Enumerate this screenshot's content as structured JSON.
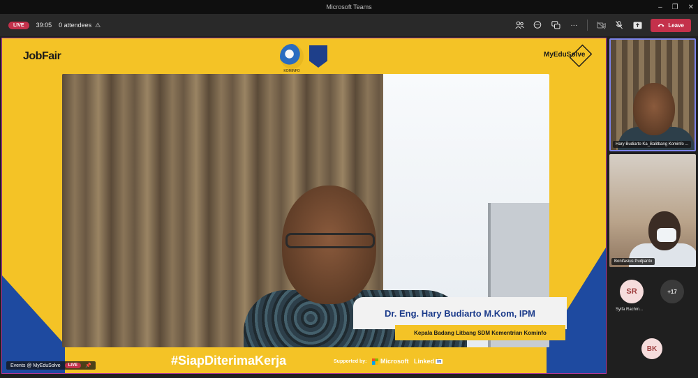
{
  "window": {
    "title": "Microsoft Teams",
    "controls": [
      "–",
      "❐",
      "✕"
    ]
  },
  "toolbar": {
    "live_badge": "LIVE",
    "timer": "39:05",
    "attendees": "0 attendees",
    "leave_label": "Leave"
  },
  "stage": {
    "brand_left": "JobFair",
    "kominfo_label": "KOMINFO",
    "brand_right": "MyEduSolve",
    "speaker_name": "Dr. Eng. Hary Budiarto M.Kom, IPM",
    "speaker_title": "Kepala Badang Litbang SDM Kementrian Kominfo",
    "hashtag": "#SiapDiterimaKerja",
    "supported_by": "Supported by:",
    "sponsor_1": "Microsoft",
    "sponsor_2": "Linked",
    "sponsor_2_box": "in",
    "event_label": "Events @ MyEduSolve",
    "event_live": "LIVE"
  },
  "participants": {
    "tile1_name": "Hary Budiarto Ka_Balitbang Kominfo ...",
    "tile2_name": "Bonifasius Pudjianto",
    "avatar_sr": "SR",
    "avatar_more": "+17",
    "avatar_sr_name": "Syifa Rachm...",
    "avatar_bk": "BK"
  },
  "colors": {
    "accent_red": "#c4314b",
    "banner_yellow": "#f4c326",
    "banner_blue": "#1e4aa0",
    "name_blue": "#1a3a8a"
  }
}
